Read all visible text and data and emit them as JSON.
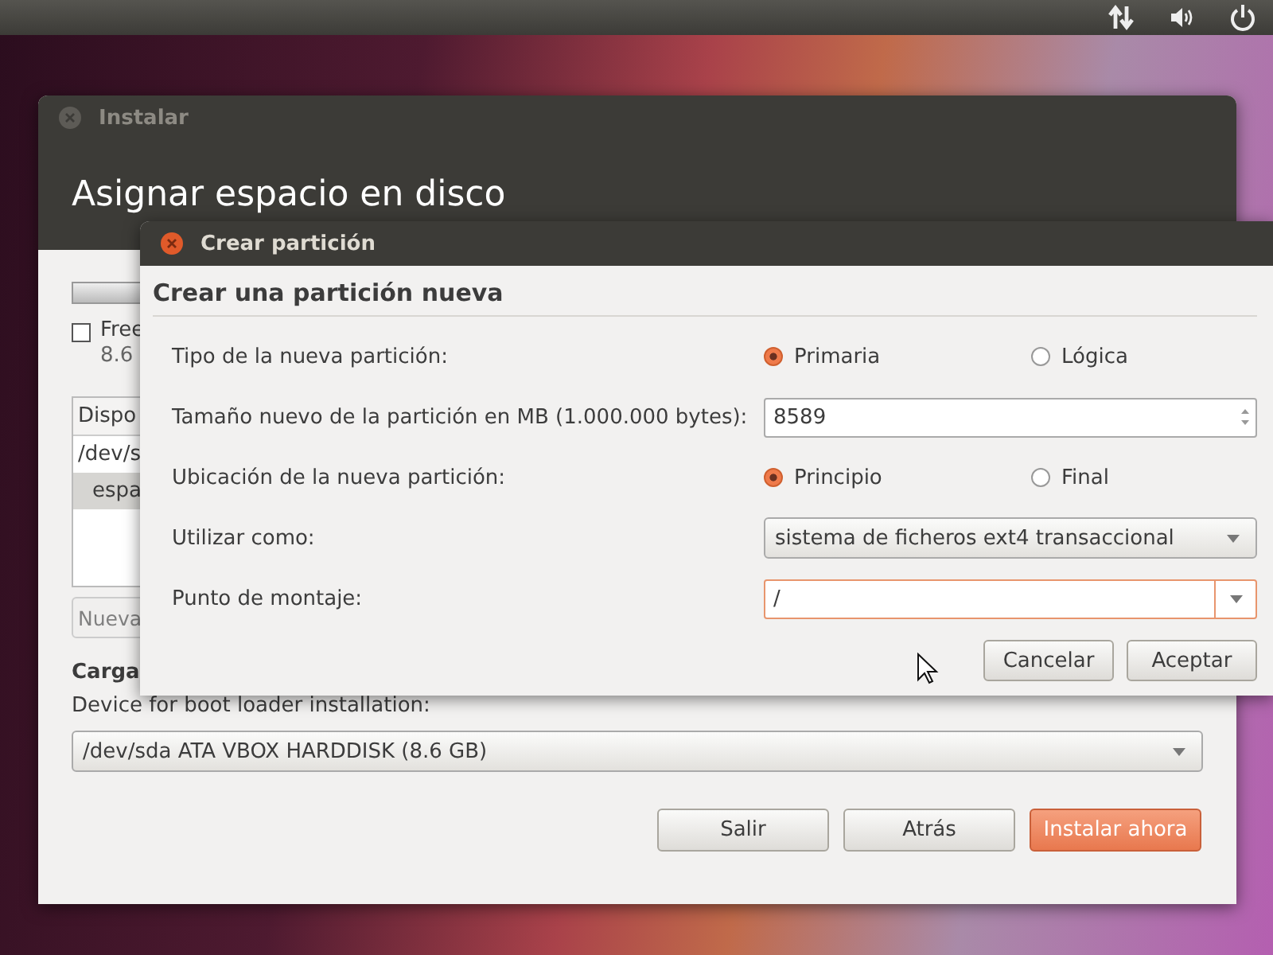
{
  "main_window": {
    "title": "Instalar",
    "heading": "Asignar espacio en disco",
    "legend": {
      "checked": false,
      "name": "Free",
      "size": "8.6"
    },
    "table": {
      "column_1": "Dispo",
      "rows": [
        {
          "cell": "/dev/s",
          "selected": false
        },
        {
          "cell": "espa",
          "selected": true
        }
      ]
    },
    "new_button": {
      "label": "Nueva",
      "disabled": true
    },
    "boot_loader": {
      "heading": "Carga",
      "label": "Device for boot loader installation:",
      "value": "/dev/sda ATA VBOX HARDDISK (8.6 GB)"
    },
    "buttons": [
      {
        "label": "Salir",
        "kind": "normal"
      },
      {
        "label": "Atrás",
        "kind": "normal"
      },
      {
        "label": "Instalar ahora",
        "kind": "suggested"
      }
    ]
  },
  "dialog": {
    "title": "Crear partición",
    "heading": "Crear una partición nueva",
    "rows": [
      {
        "label": "Tipo de la nueva partición:",
        "kind": "radio",
        "options": [
          {
            "label": "Primaria",
            "selected": true
          },
          {
            "label": "Lógica",
            "selected": false
          }
        ]
      },
      {
        "label": "Tamaño nuevo de la partición en MB (1.000.000 bytes):",
        "kind": "spin",
        "value": "8589"
      },
      {
        "label": "Ubicación de la nueva partición:",
        "kind": "radio",
        "options": [
          {
            "label": "Principio",
            "selected": true
          },
          {
            "label": "Final",
            "selected": false
          }
        ]
      },
      {
        "label": "Utilizar como:",
        "kind": "combo",
        "value": "sistema de ficheros ext4 transaccional"
      },
      {
        "label": "Punto de montaje:",
        "kind": "entry_combo",
        "value": "/",
        "focused": true
      }
    ],
    "buttons": [
      "Cancelar",
      "Aceptar"
    ]
  }
}
